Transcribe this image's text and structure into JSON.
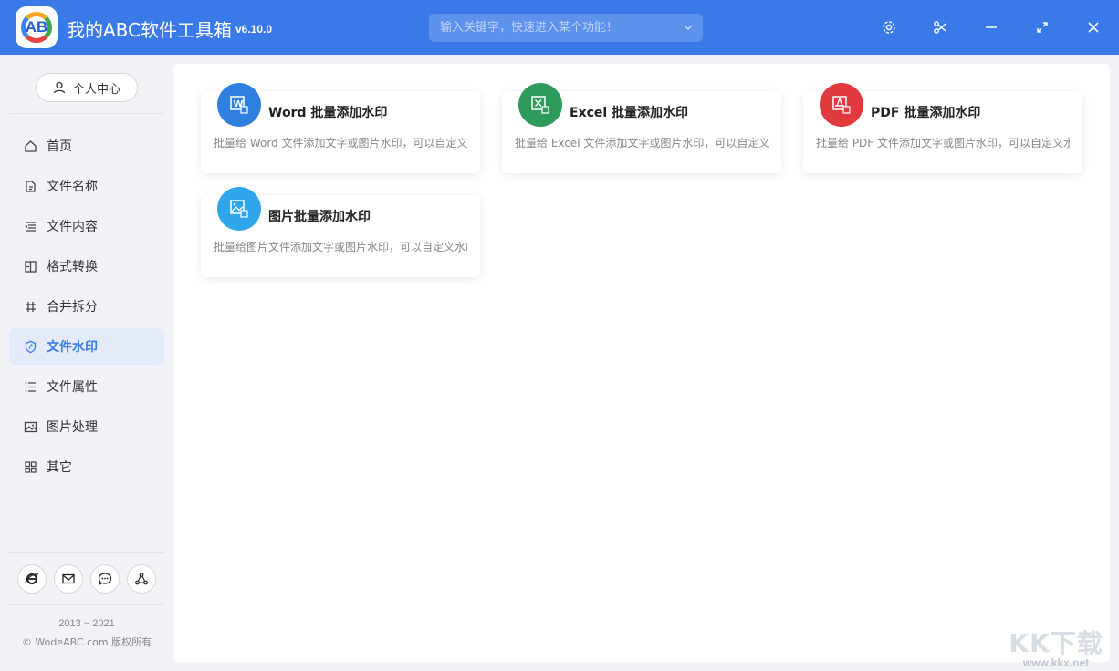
{
  "app": {
    "title": "我的ABC软件工具箱",
    "version": "v6.10.0",
    "logo_text": "AB"
  },
  "search": {
    "placeholder": "输入关键字，快速进入某个功能！"
  },
  "window_controls": [
    "gear-icon",
    "scissors-icon",
    "minimize-icon",
    "maximize-icon",
    "close-icon"
  ],
  "sidebar": {
    "user_center": "个人中心",
    "items": [
      {
        "label": "首页",
        "icon": "home-icon",
        "active": false
      },
      {
        "label": "文件名称",
        "icon": "file-name-icon",
        "active": false
      },
      {
        "label": "文件内容",
        "icon": "file-content-icon",
        "active": false
      },
      {
        "label": "格式转换",
        "icon": "format-convert-icon",
        "active": false
      },
      {
        "label": "合并拆分",
        "icon": "merge-split-icon",
        "active": false
      },
      {
        "label": "文件水印",
        "icon": "watermark-icon",
        "active": true
      },
      {
        "label": "文件属性",
        "icon": "file-properties-icon",
        "active": false
      },
      {
        "label": "图片处理",
        "icon": "image-process-icon",
        "active": false
      },
      {
        "label": "其它",
        "icon": "other-icon",
        "active": false
      }
    ],
    "social": [
      "ie-icon",
      "mail-icon",
      "chat-icon",
      "share-icon"
    ],
    "copyright_years": "2013 ~ 2021",
    "copyright_text": "© WodeABC.com 版权所有"
  },
  "cards": [
    {
      "title": "Word 批量添加水印",
      "desc": "批量给 Word 文件添加文字或图片水印，可以自定义水印",
      "icon": "word-icon",
      "color": "#2f7fe0"
    },
    {
      "title": "Excel 批量添加水印",
      "desc": "批量给 Excel 文件添加文字或图片水印，可以自定义水印",
      "icon": "excel-icon",
      "color": "#2e9b5c"
    },
    {
      "title": "PDF 批量添加水印",
      "desc": "批量给 PDF 文件添加文字或图片水印，可以自定义水印",
      "icon": "pdf-icon",
      "color": "#e0393e"
    },
    {
      "title": "图片批量添加水印",
      "desc": "批量给图片文件添加文字或图片水印，可以自定义水印",
      "icon": "image-icon",
      "color": "#2fa6ea"
    }
  ],
  "watermark": {
    "big": "KK下载",
    "small": "www.kkx.net"
  },
  "colors": {
    "accent": "#3979e8",
    "active_bg": "#e3ebf8"
  }
}
